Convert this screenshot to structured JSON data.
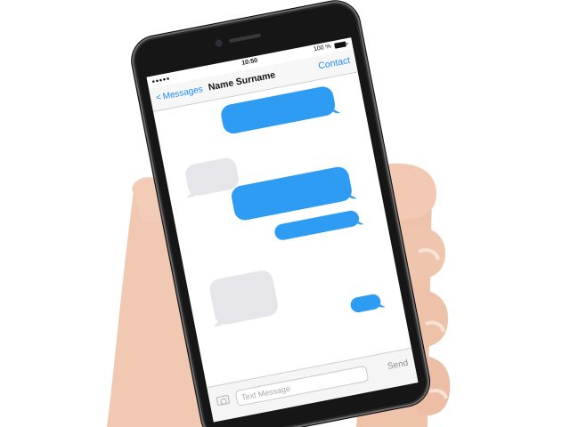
{
  "status_bar": {
    "signal": "●●●●●",
    "time": "10:50",
    "battery": "100 %"
  },
  "nav": {
    "back_label": "Messages",
    "title": "Name Surname",
    "contact_label": "Contact"
  },
  "messages": [
    {
      "direction": "outgoing",
      "text": ""
    },
    {
      "direction": "incoming",
      "text": ""
    },
    {
      "direction": "outgoing",
      "text": ""
    },
    {
      "direction": "outgoing",
      "text": ""
    },
    {
      "direction": "incoming",
      "text": ""
    },
    {
      "direction": "outgoing",
      "text": ""
    }
  ],
  "composer": {
    "placeholder": "Text Message",
    "value": "",
    "send_label": "Send"
  },
  "icons": {
    "back": "chevron-left-icon",
    "camera": "camera-icon",
    "battery": "battery-icon"
  },
  "colors": {
    "outgoing_bubble": "#2f9cf4",
    "incoming_bubble": "#e6e6ea",
    "accent": "#1a8cff",
    "phone_body": "#161616"
  }
}
